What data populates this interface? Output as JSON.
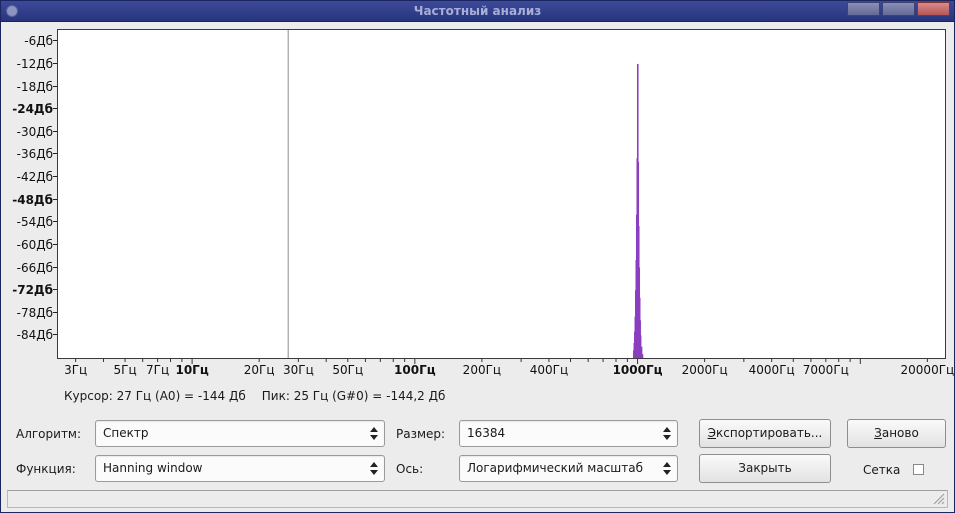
{
  "window": {
    "title": "Частотный анализ"
  },
  "chart_data": {
    "type": "bar",
    "x_scale": "log",
    "xlim": [
      2.5,
      24000
    ],
    "ylim": [
      -90,
      -3
    ],
    "y_ticks": [
      "-6Дб",
      "-12Дб",
      "-18Дб",
      "-24Дб",
      "-30Дб",
      "-36Дб",
      "-42Дб",
      "-48Дб",
      "-54Дб",
      "-60Дб",
      "-66Дб",
      "-72Дб",
      "-78Дб",
      "-84Дб"
    ],
    "y_tick_values": [
      -6,
      -12,
      -18,
      -24,
      -30,
      -36,
      -42,
      -48,
      -54,
      -60,
      -66,
      -72,
      -78,
      -84
    ],
    "y_bold_ticks": [
      "-24Дб",
      "-48Дб",
      "-72Дб"
    ],
    "x_ticks": [
      "3Гц",
      "5Гц",
      "7Гц",
      "10Гц",
      "20Гц",
      "30Гц",
      "50Гц",
      "100Гц",
      "200Гц",
      "400Гц",
      "1000Гц",
      "2000Гц",
      "4000Гц",
      "7000Гц",
      "20000Гц"
    ],
    "x_tick_values": [
      3,
      5,
      7,
      10,
      20,
      30,
      50,
      100,
      200,
      400,
      1000,
      2000,
      4000,
      7000,
      20000
    ],
    "x_bold_ticks": [
      "10Гц",
      "100Гц",
      "1000Гц"
    ],
    "cursor_hz": 27,
    "series": [
      {
        "color": "#8b3fbf",
        "points": [
          [
            955,
            -90
          ],
          [
            960,
            -88
          ],
          [
            965,
            -86
          ],
          [
            970,
            -83
          ],
          [
            975,
            -79
          ],
          [
            980,
            -72
          ],
          [
            985,
            -64
          ],
          [
            990,
            -52
          ],
          [
            995,
            -37
          ],
          [
            1000,
            -12
          ],
          [
            1005,
            -38
          ],
          [
            1010,
            -55
          ],
          [
            1015,
            -66
          ],
          [
            1020,
            -74
          ],
          [
            1025,
            -80
          ],
          [
            1030,
            -84
          ],
          [
            1040,
            -87
          ],
          [
            1050,
            -89
          ]
        ]
      }
    ]
  },
  "info": {
    "cursor": "Курсор: 27 Гц (A0) = -144 Дб",
    "peak": "Пик: 25 Гц (G#0) = -144,2 Дб"
  },
  "controls": {
    "algorithm_label": "Алгоритм:",
    "algorithm_value": "Спектр",
    "function_label": "Функция:",
    "function_value": "Hanning window",
    "size_label": "Размер:",
    "size_value": "16384",
    "axis_label": "Ось:",
    "axis_value": "Логарифмический масштаб",
    "export_hotkey": "Э",
    "export_rest": "кспортировать...",
    "replot_hotkey": "З",
    "replot_rest": "аново",
    "close_label": "Закрыть",
    "grid_label": "Сетка",
    "grid_checked": false
  }
}
